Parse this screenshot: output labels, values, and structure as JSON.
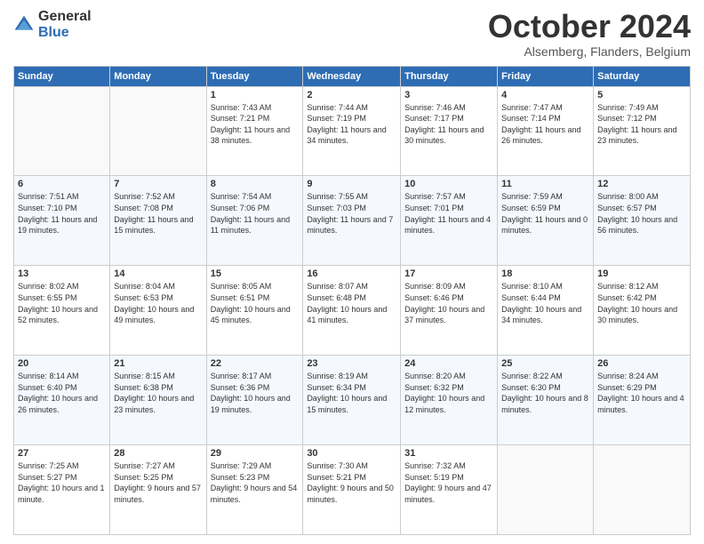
{
  "logo": {
    "general": "General",
    "blue": "Blue"
  },
  "header": {
    "month": "October 2024",
    "location": "Alsemberg, Flanders, Belgium"
  },
  "columns": [
    "Sunday",
    "Monday",
    "Tuesday",
    "Wednesday",
    "Thursday",
    "Friday",
    "Saturday"
  ],
  "weeks": [
    [
      {
        "day": "",
        "sunrise": "",
        "sunset": "",
        "daylight": ""
      },
      {
        "day": "",
        "sunrise": "",
        "sunset": "",
        "daylight": ""
      },
      {
        "day": "1",
        "sunrise": "Sunrise: 7:43 AM",
        "sunset": "Sunset: 7:21 PM",
        "daylight": "Daylight: 11 hours and 38 minutes."
      },
      {
        "day": "2",
        "sunrise": "Sunrise: 7:44 AM",
        "sunset": "Sunset: 7:19 PM",
        "daylight": "Daylight: 11 hours and 34 minutes."
      },
      {
        "day": "3",
        "sunrise": "Sunrise: 7:46 AM",
        "sunset": "Sunset: 7:17 PM",
        "daylight": "Daylight: 11 hours and 30 minutes."
      },
      {
        "day": "4",
        "sunrise": "Sunrise: 7:47 AM",
        "sunset": "Sunset: 7:14 PM",
        "daylight": "Daylight: 11 hours and 26 minutes."
      },
      {
        "day": "5",
        "sunrise": "Sunrise: 7:49 AM",
        "sunset": "Sunset: 7:12 PM",
        "daylight": "Daylight: 11 hours and 23 minutes."
      }
    ],
    [
      {
        "day": "6",
        "sunrise": "Sunrise: 7:51 AM",
        "sunset": "Sunset: 7:10 PM",
        "daylight": "Daylight: 11 hours and 19 minutes."
      },
      {
        "day": "7",
        "sunrise": "Sunrise: 7:52 AM",
        "sunset": "Sunset: 7:08 PM",
        "daylight": "Daylight: 11 hours and 15 minutes."
      },
      {
        "day": "8",
        "sunrise": "Sunrise: 7:54 AM",
        "sunset": "Sunset: 7:06 PM",
        "daylight": "Daylight: 11 hours and 11 minutes."
      },
      {
        "day": "9",
        "sunrise": "Sunrise: 7:55 AM",
        "sunset": "Sunset: 7:03 PM",
        "daylight": "Daylight: 11 hours and 7 minutes."
      },
      {
        "day": "10",
        "sunrise": "Sunrise: 7:57 AM",
        "sunset": "Sunset: 7:01 PM",
        "daylight": "Daylight: 11 hours and 4 minutes."
      },
      {
        "day": "11",
        "sunrise": "Sunrise: 7:59 AM",
        "sunset": "Sunset: 6:59 PM",
        "daylight": "Daylight: 11 hours and 0 minutes."
      },
      {
        "day": "12",
        "sunrise": "Sunrise: 8:00 AM",
        "sunset": "Sunset: 6:57 PM",
        "daylight": "Daylight: 10 hours and 56 minutes."
      }
    ],
    [
      {
        "day": "13",
        "sunrise": "Sunrise: 8:02 AM",
        "sunset": "Sunset: 6:55 PM",
        "daylight": "Daylight: 10 hours and 52 minutes."
      },
      {
        "day": "14",
        "sunrise": "Sunrise: 8:04 AM",
        "sunset": "Sunset: 6:53 PM",
        "daylight": "Daylight: 10 hours and 49 minutes."
      },
      {
        "day": "15",
        "sunrise": "Sunrise: 8:05 AM",
        "sunset": "Sunset: 6:51 PM",
        "daylight": "Daylight: 10 hours and 45 minutes."
      },
      {
        "day": "16",
        "sunrise": "Sunrise: 8:07 AM",
        "sunset": "Sunset: 6:48 PM",
        "daylight": "Daylight: 10 hours and 41 minutes."
      },
      {
        "day": "17",
        "sunrise": "Sunrise: 8:09 AM",
        "sunset": "Sunset: 6:46 PM",
        "daylight": "Daylight: 10 hours and 37 minutes."
      },
      {
        "day": "18",
        "sunrise": "Sunrise: 8:10 AM",
        "sunset": "Sunset: 6:44 PM",
        "daylight": "Daylight: 10 hours and 34 minutes."
      },
      {
        "day": "19",
        "sunrise": "Sunrise: 8:12 AM",
        "sunset": "Sunset: 6:42 PM",
        "daylight": "Daylight: 10 hours and 30 minutes."
      }
    ],
    [
      {
        "day": "20",
        "sunrise": "Sunrise: 8:14 AM",
        "sunset": "Sunset: 6:40 PM",
        "daylight": "Daylight: 10 hours and 26 minutes."
      },
      {
        "day": "21",
        "sunrise": "Sunrise: 8:15 AM",
        "sunset": "Sunset: 6:38 PM",
        "daylight": "Daylight: 10 hours and 23 minutes."
      },
      {
        "day": "22",
        "sunrise": "Sunrise: 8:17 AM",
        "sunset": "Sunset: 6:36 PM",
        "daylight": "Daylight: 10 hours and 19 minutes."
      },
      {
        "day": "23",
        "sunrise": "Sunrise: 8:19 AM",
        "sunset": "Sunset: 6:34 PM",
        "daylight": "Daylight: 10 hours and 15 minutes."
      },
      {
        "day": "24",
        "sunrise": "Sunrise: 8:20 AM",
        "sunset": "Sunset: 6:32 PM",
        "daylight": "Daylight: 10 hours and 12 minutes."
      },
      {
        "day": "25",
        "sunrise": "Sunrise: 8:22 AM",
        "sunset": "Sunset: 6:30 PM",
        "daylight": "Daylight: 10 hours and 8 minutes."
      },
      {
        "day": "26",
        "sunrise": "Sunrise: 8:24 AM",
        "sunset": "Sunset: 6:29 PM",
        "daylight": "Daylight: 10 hours and 4 minutes."
      }
    ],
    [
      {
        "day": "27",
        "sunrise": "Sunrise: 7:25 AM",
        "sunset": "Sunset: 5:27 PM",
        "daylight": "Daylight: 10 hours and 1 minute."
      },
      {
        "day": "28",
        "sunrise": "Sunrise: 7:27 AM",
        "sunset": "Sunset: 5:25 PM",
        "daylight": "Daylight: 9 hours and 57 minutes."
      },
      {
        "day": "29",
        "sunrise": "Sunrise: 7:29 AM",
        "sunset": "Sunset: 5:23 PM",
        "daylight": "Daylight: 9 hours and 54 minutes."
      },
      {
        "day": "30",
        "sunrise": "Sunrise: 7:30 AM",
        "sunset": "Sunset: 5:21 PM",
        "daylight": "Daylight: 9 hours and 50 minutes."
      },
      {
        "day": "31",
        "sunrise": "Sunrise: 7:32 AM",
        "sunset": "Sunset: 5:19 PM",
        "daylight": "Daylight: 9 hours and 47 minutes."
      },
      {
        "day": "",
        "sunrise": "",
        "sunset": "",
        "daylight": ""
      },
      {
        "day": "",
        "sunrise": "",
        "sunset": "",
        "daylight": ""
      }
    ]
  ]
}
